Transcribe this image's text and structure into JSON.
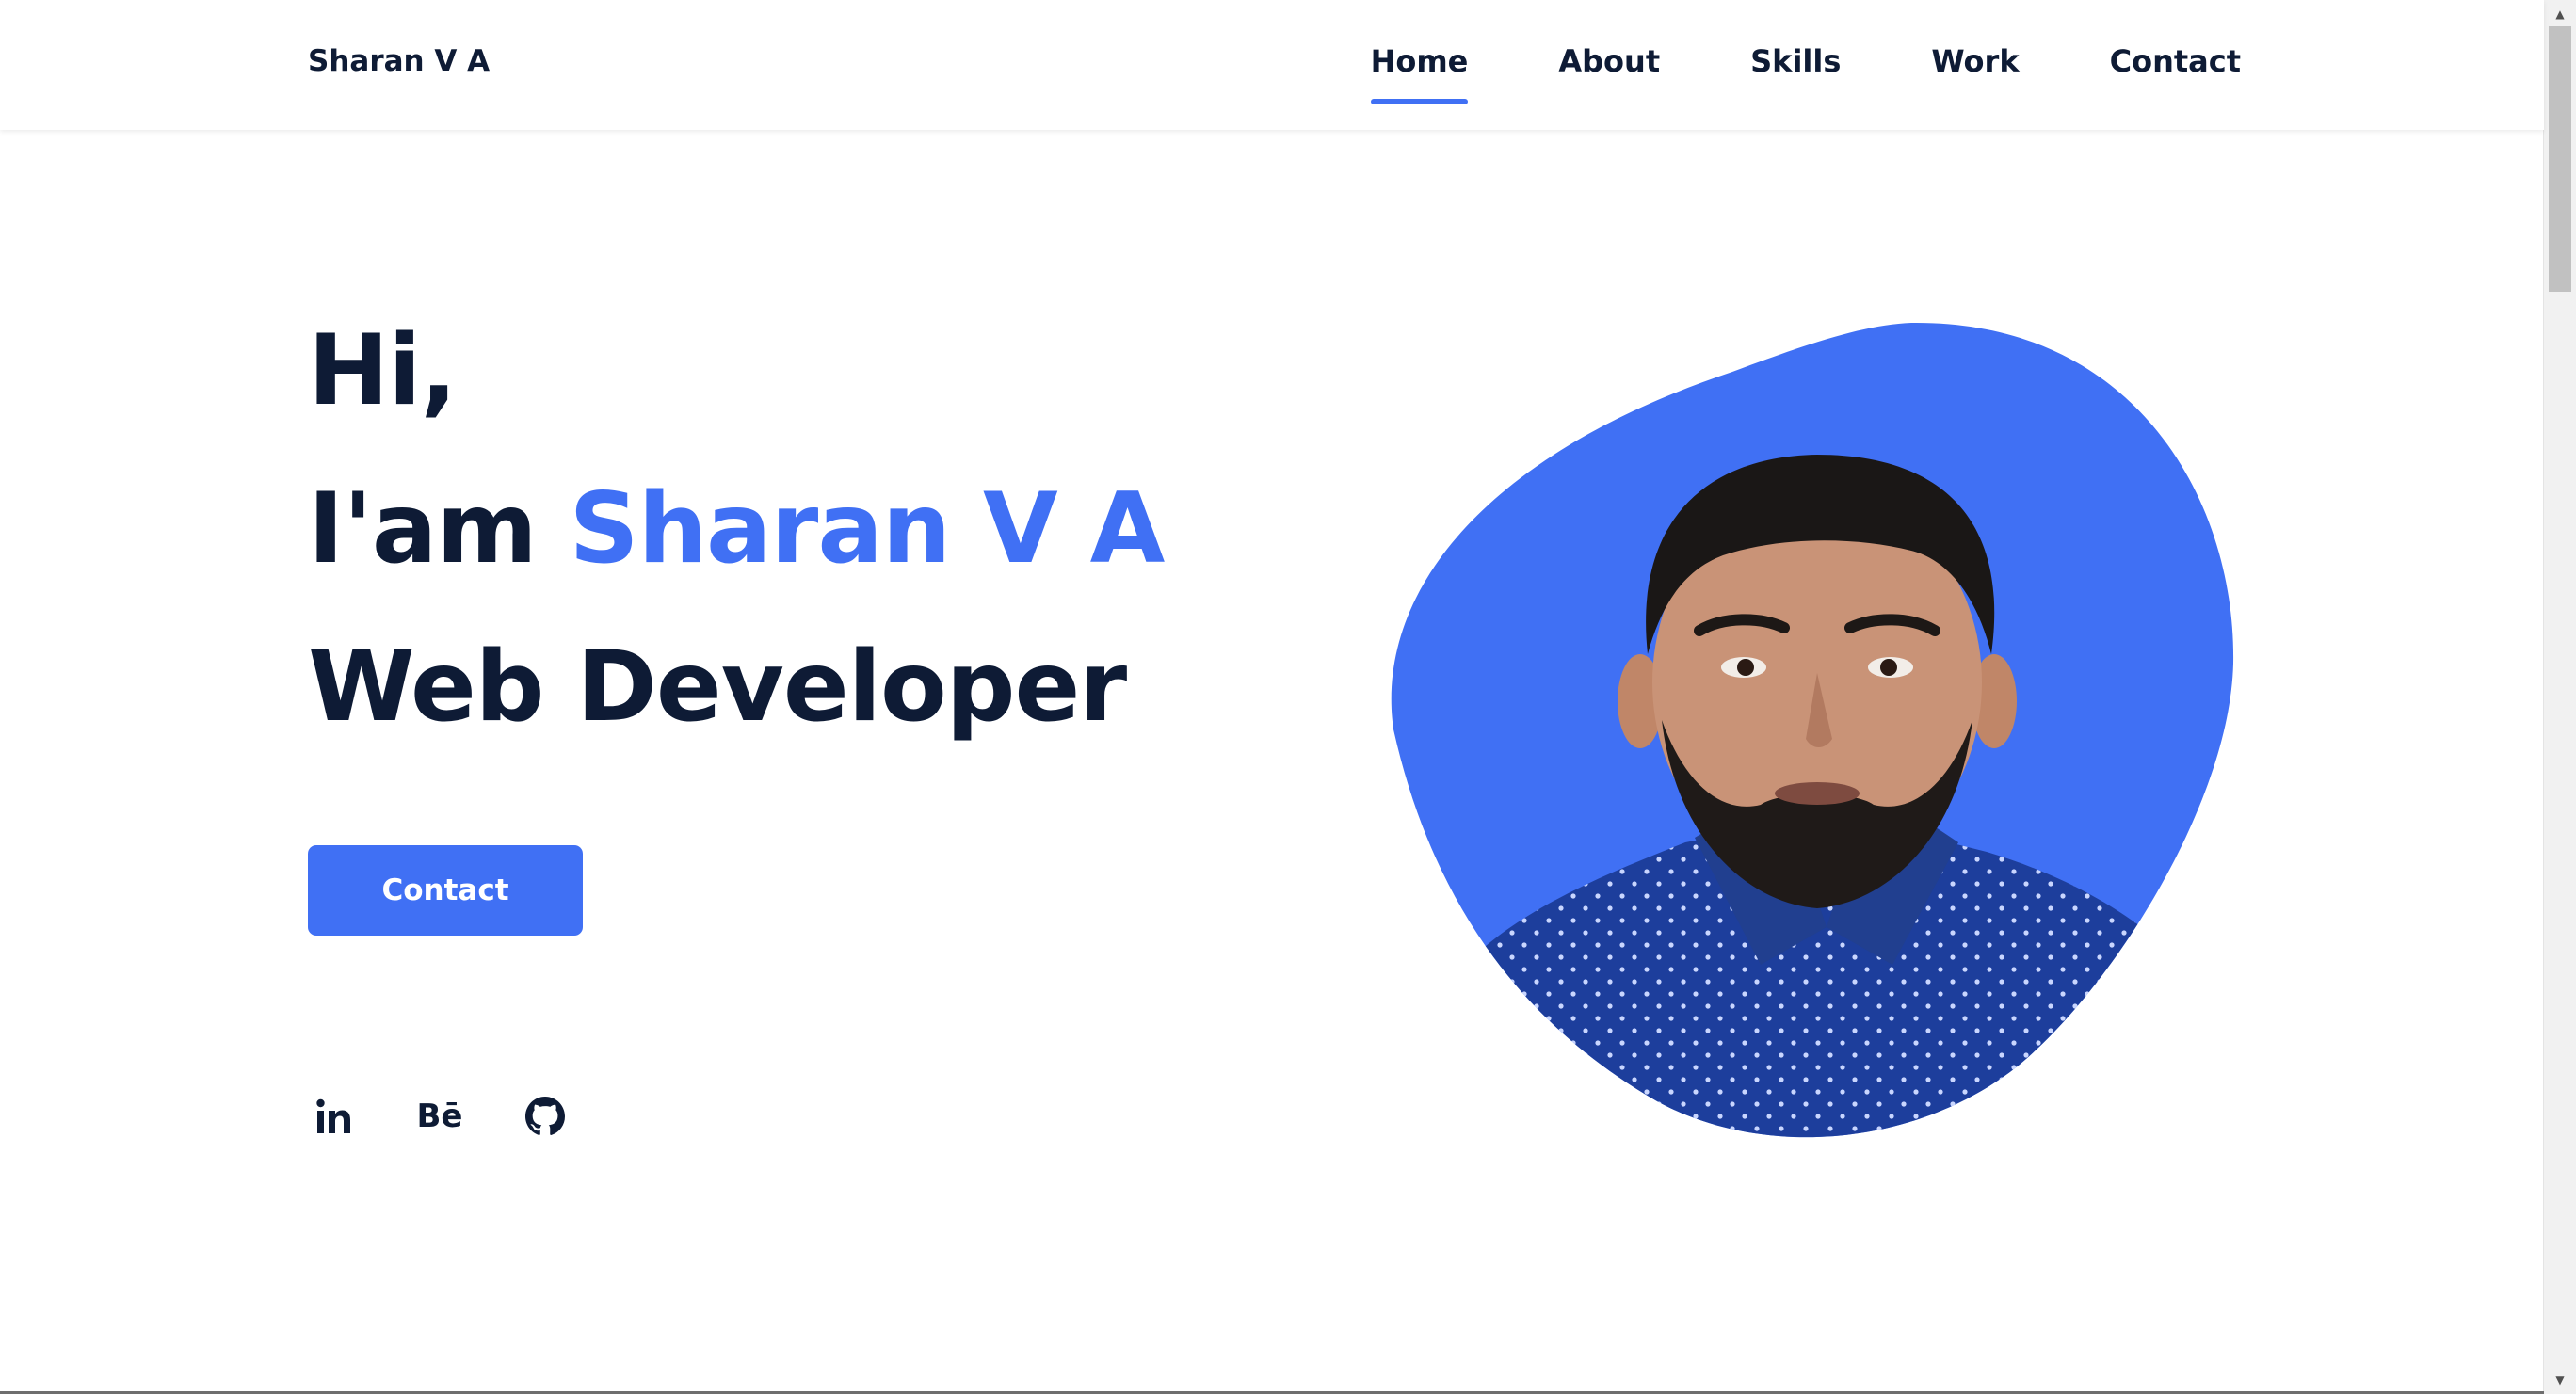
{
  "header": {
    "logo": "Sharan V A",
    "nav": [
      {
        "label": "Home",
        "active": true
      },
      {
        "label": "About",
        "active": false
      },
      {
        "label": "Skills",
        "active": false
      },
      {
        "label": "Work",
        "active": false
      },
      {
        "label": "Contact",
        "active": false
      }
    ]
  },
  "hero": {
    "greeting": "Hi,",
    "intro_prefix": "I'am",
    "name": "Sharan V A",
    "role": "Web Developer",
    "contact_button": "Contact"
  },
  "socials": [
    {
      "icon": "linkedin-icon",
      "text": "in"
    },
    {
      "icon": "behance-icon",
      "text": "Bē"
    },
    {
      "icon": "github-icon",
      "text": ""
    }
  ],
  "colors": {
    "accent": "#4070f4",
    "text": "#0e1b35",
    "background": "#ffffff",
    "shirt": "#1c3ea0",
    "skin": "#c99377"
  }
}
